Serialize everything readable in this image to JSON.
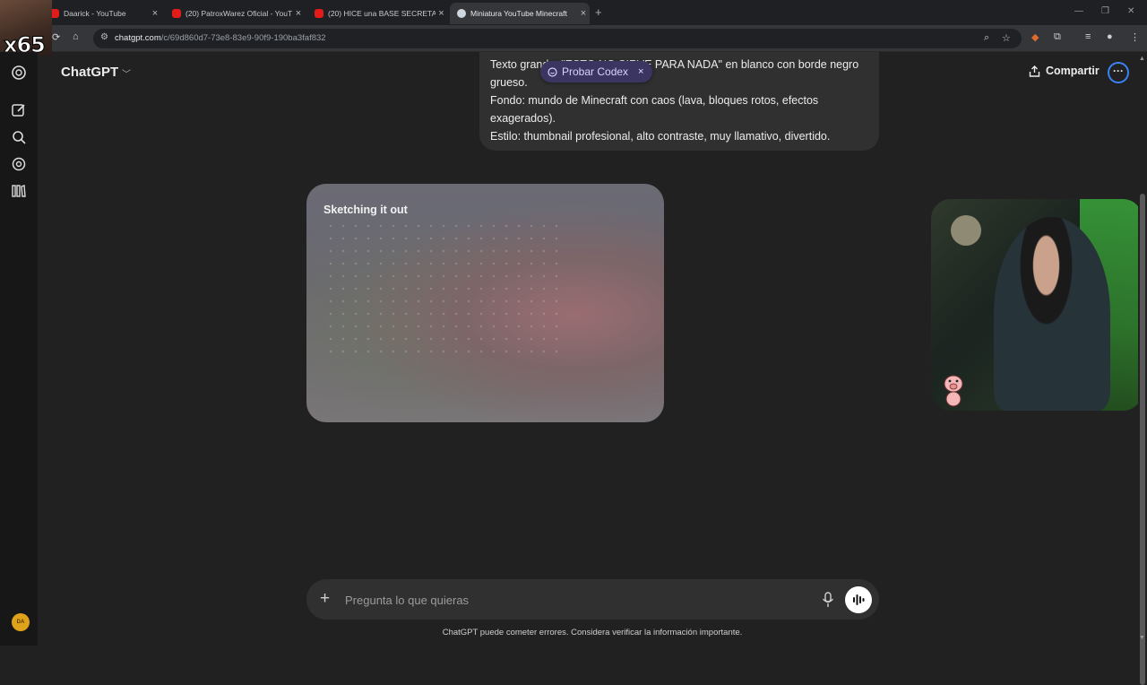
{
  "browser": {
    "tabs": [
      {
        "title": "Daarick - YouTube",
        "favicon": "youtube-icon",
        "active": false
      },
      {
        "title": "(20) PatroxWarez Oficial - YouT",
        "favicon": "youtube-icon",
        "active": false
      },
      {
        "title": "(20) HICE una BASE SECRETA d",
        "favicon": "youtube-icon",
        "active": false
      },
      {
        "title": "Miniatura YouTube Minecraft",
        "favicon": "chatgpt-icon",
        "active": true
      }
    ],
    "url_host": "chatgpt.com",
    "url_path": "/c/69d860d7-73e8-83e9-90f9-190ba3faf832"
  },
  "overlay": {
    "counter": "x65"
  },
  "header": {
    "title": "ChatGPT",
    "share_label": "Compartir"
  },
  "conversation": {
    "user_message_lines": [
      "Texto grande: \"ESTO NO SIRVE PARA NADA\" en blanco con borde negro grueso.",
      "Fondo: mundo de Minecraft con caos (lava, bloques rotos, efectos exagerados).",
      "Estilo: thumbnail profesional, alto contraste, muy llamativo, divertido."
    ],
    "image_status": "Sketching it out"
  },
  "codex_pill": {
    "label": "Probar Codex"
  },
  "composer": {
    "placeholder": "Pregunta lo que quieras"
  },
  "footer": {
    "disclaimer": "ChatGPT puede cometer errores. Considera verificar la información importante."
  },
  "user": {
    "avatar_initials": "DA",
    "avatar_color": "#e0a21a"
  },
  "colors": {
    "background": "#212121",
    "sidebar": "#171717",
    "bubble": "#303030",
    "codex_pill": "#3b3561",
    "accent_ring": "#3b82f6"
  }
}
